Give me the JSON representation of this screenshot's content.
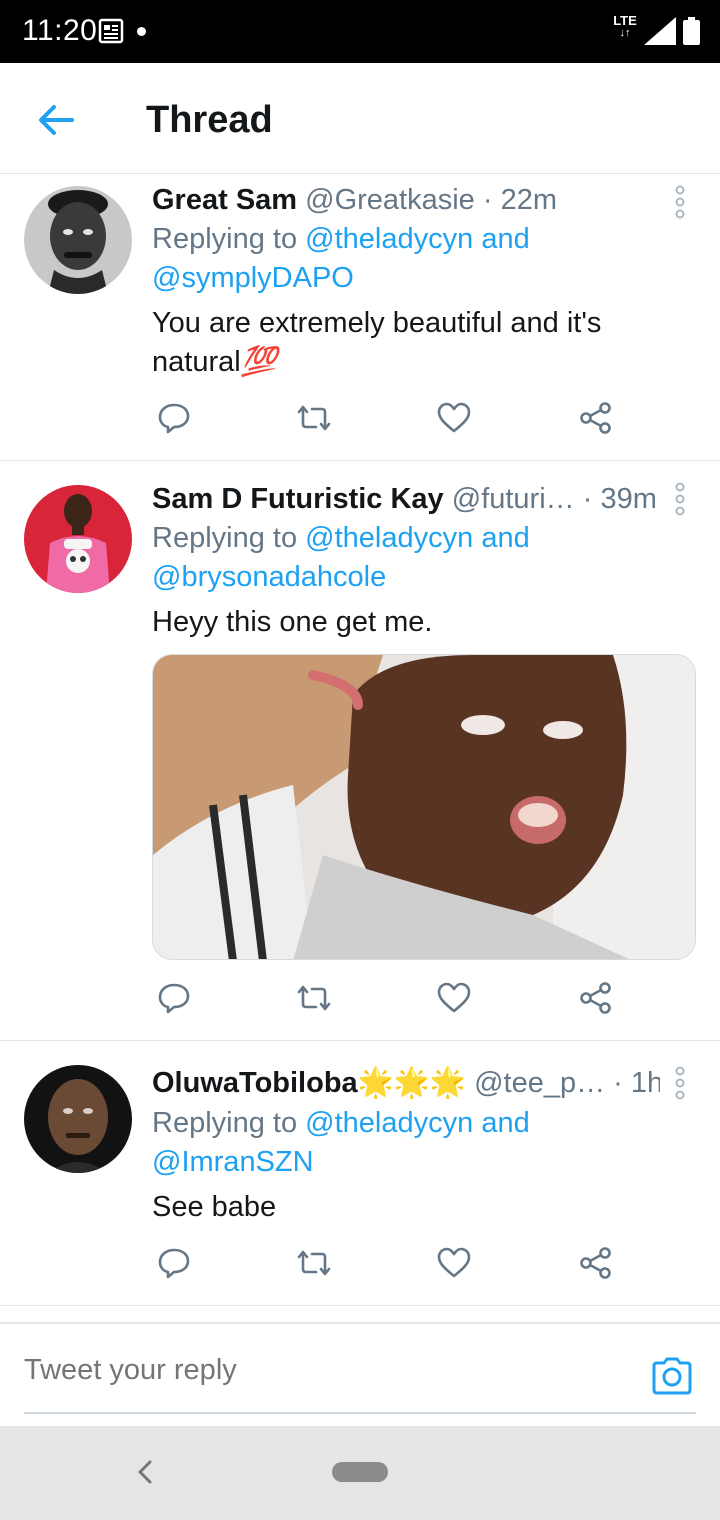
{
  "status_bar": {
    "time": "11:20",
    "network": "LTE"
  },
  "header": {
    "title": "Thread"
  },
  "tweets": [
    {
      "display_name": "Great Sam",
      "handle": "@Greatkasie",
      "time": "· 22m",
      "replying_to_prefix": "Replying to",
      "mention_1": "@theladycyn",
      "and": "and",
      "mention_2": "@symplyDAPO",
      "text_line1": "You are extremely beautiful and it's",
      "text_line2": "natural",
      "emoji": "💯"
    },
    {
      "display_name": "Sam D Futuristic Kay",
      "handle": "@futuri…",
      "time": "· 39m",
      "replying_to_prefix": "Replying to",
      "mention_1": "@theladycyn",
      "and": "and",
      "mention_2": "@brysonadahcole",
      "text_line1": "Heyy this one get me."
    },
    {
      "display_name": "OluwaTobiloba",
      "name_emoji": "🌟🌟🌟",
      "handle": "@tee_p…",
      "time": "· 1h",
      "replying_to_prefix": "Replying to",
      "mention_1": "@theladycyn",
      "and": "and",
      "mention_2": "@ImranSZN",
      "text_line1": "See babe"
    }
  ],
  "reply_bar": {
    "placeholder": "Tweet your reply"
  },
  "colors": {
    "accent": "#1da1f2",
    "secondary_text": "#657786",
    "primary_text": "#14171a",
    "divider": "#e1e8ed"
  },
  "icons": [
    "back-arrow-icon",
    "more-vertical-icon",
    "reply-icon",
    "retweet-icon",
    "like-icon",
    "share-icon",
    "camera-icon"
  ]
}
